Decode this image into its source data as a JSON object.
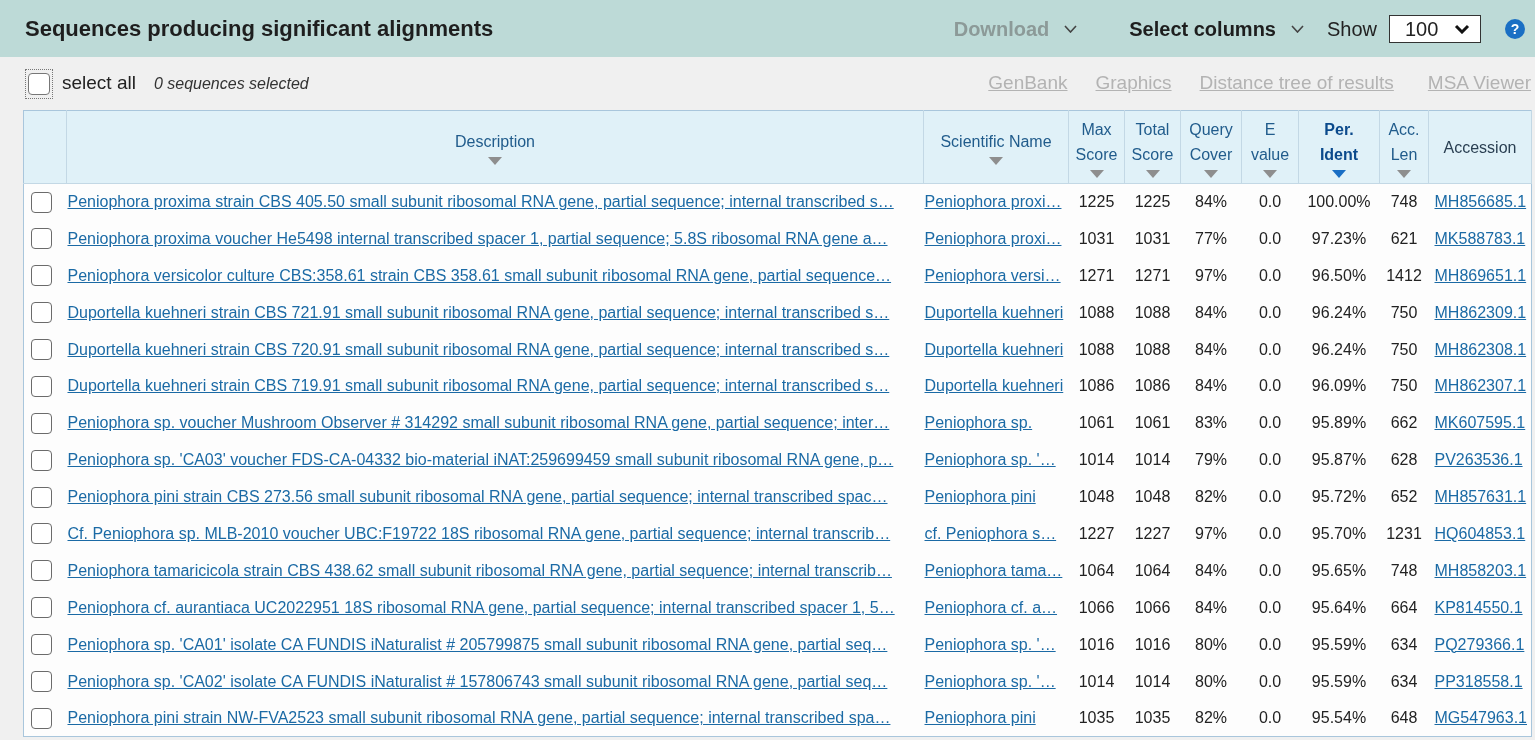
{
  "header": {
    "title": "Sequences producing significant alignments",
    "download": {
      "label": "Download",
      "disabled": true
    },
    "select_columns": {
      "label": "Select columns",
      "disabled": false
    },
    "show": {
      "label": "Show",
      "value": "100"
    },
    "help": {
      "label": "?"
    }
  },
  "toolbar": {
    "select_all": {
      "label": "select all",
      "checked": false,
      "focused": true
    },
    "selection_count": "0 sequences selected",
    "links": [
      {
        "label": "GenBank",
        "disabled": true
      },
      {
        "label": "Graphics",
        "disabled": true
      },
      {
        "label": "Distance tree of results",
        "disabled": true
      },
      {
        "label": "MSA Viewer",
        "disabled": true
      }
    ]
  },
  "table": {
    "columns": [
      {
        "label": "Description",
        "sortable": true,
        "sorted": false
      },
      {
        "label": "Scientific Name",
        "sortable": true,
        "sorted": false
      },
      {
        "label": "Max Score",
        "sortable": true,
        "sorted": false
      },
      {
        "label": "Total Score",
        "sortable": true,
        "sorted": false
      },
      {
        "label": "Query Cover",
        "sortable": true,
        "sorted": false
      },
      {
        "label": "E value",
        "sortable": true,
        "sorted": false
      },
      {
        "label": "Per. Ident",
        "sortable": true,
        "sorted": true
      },
      {
        "label": "Acc. Len",
        "sortable": true,
        "sorted": false
      },
      {
        "label": "Accession",
        "sortable": false,
        "sorted": false
      }
    ],
    "rows": [
      {
        "checked": false,
        "description": "Peniophora proxima strain CBS 405.50 small subunit ribosomal RNA gene, partial sequence; internal transcribed s…",
        "scientific_name": "Peniophora proxi…",
        "max_score": "1225",
        "total_score": "1225",
        "query_cover": "84%",
        "e_value": "0.0",
        "per_ident": "100.00%",
        "acc_len": "748",
        "accession": "MH856685.1"
      },
      {
        "checked": false,
        "description": "Peniophora proxima voucher He5498 internal transcribed spacer 1, partial sequence; 5.8S ribosomal RNA gene a…",
        "scientific_name": "Peniophora proxi…",
        "max_score": "1031",
        "total_score": "1031",
        "query_cover": "77%",
        "e_value": "0.0",
        "per_ident": "97.23%",
        "acc_len": "621",
        "accession": "MK588783.1"
      },
      {
        "checked": false,
        "description": "Peniophora versicolor culture CBS:358.61 strain CBS 358.61 small subunit ribosomal RNA gene, partial sequence…",
        "scientific_name": "Peniophora versi…",
        "max_score": "1271",
        "total_score": "1271",
        "query_cover": "97%",
        "e_value": "0.0",
        "per_ident": "96.50%",
        "acc_len": "1412",
        "accession": "MH869651.1"
      },
      {
        "checked": false,
        "description": "Duportella kuehneri strain CBS 721.91 small subunit ribosomal RNA gene, partial sequence; internal transcribed s…",
        "scientific_name": "Duportella kuehneri",
        "max_score": "1088",
        "total_score": "1088",
        "query_cover": "84%",
        "e_value": "0.0",
        "per_ident": "96.24%",
        "acc_len": "750",
        "accession": "MH862309.1"
      },
      {
        "checked": false,
        "description": "Duportella kuehneri strain CBS 720.91 small subunit ribosomal RNA gene, partial sequence; internal transcribed s…",
        "scientific_name": "Duportella kuehneri",
        "max_score": "1088",
        "total_score": "1088",
        "query_cover": "84%",
        "e_value": "0.0",
        "per_ident": "96.24%",
        "acc_len": "750",
        "accession": "MH862308.1"
      },
      {
        "checked": false,
        "description": "Duportella kuehneri strain CBS 719.91 small subunit ribosomal RNA gene, partial sequence; internal transcribed s…",
        "scientific_name": "Duportella kuehneri",
        "max_score": "1086",
        "total_score": "1086",
        "query_cover": "84%",
        "e_value": "0.0",
        "per_ident": "96.09%",
        "acc_len": "750",
        "accession": "MH862307.1"
      },
      {
        "checked": false,
        "description": "Peniophora sp. voucher Mushroom Observer # 314292 small subunit ribosomal RNA gene, partial sequence; inter…",
        "scientific_name": "Peniophora sp.",
        "max_score": "1061",
        "total_score": "1061",
        "query_cover": "83%",
        "e_value": "0.0",
        "per_ident": "95.89%",
        "acc_len": "662",
        "accession": "MK607595.1"
      },
      {
        "checked": false,
        "description": "Peniophora sp. 'CA03' voucher FDS-CA-04332 bio-material iNAT:259699459 small subunit ribosomal RNA gene, p…",
        "scientific_name": "Peniophora sp. '…",
        "max_score": "1014",
        "total_score": "1014",
        "query_cover": "79%",
        "e_value": "0.0",
        "per_ident": "95.87%",
        "acc_len": "628",
        "accession": "PV263536.1"
      },
      {
        "checked": false,
        "description": "Peniophora pini strain CBS 273.56 small subunit ribosomal RNA gene, partial sequence; internal transcribed spac…",
        "scientific_name": "Peniophora pini",
        "max_score": "1048",
        "total_score": "1048",
        "query_cover": "82%",
        "e_value": "0.0",
        "per_ident": "95.72%",
        "acc_len": "652",
        "accession": "MH857631.1"
      },
      {
        "checked": false,
        "description": "Cf. Peniophora sp. MLB-2010 voucher UBC:F19722 18S ribosomal RNA gene, partial sequence; internal transcrib…",
        "scientific_name": "cf. Peniophora s…",
        "max_score": "1227",
        "total_score": "1227",
        "query_cover": "97%",
        "e_value": "0.0",
        "per_ident": "95.70%",
        "acc_len": "1231",
        "accession": "HQ604853.1"
      },
      {
        "checked": false,
        "description": "Peniophora tamaricicola strain CBS 438.62 small subunit ribosomal RNA gene, partial sequence; internal transcrib…",
        "scientific_name": "Peniophora tama…",
        "max_score": "1064",
        "total_score": "1064",
        "query_cover": "84%",
        "e_value": "0.0",
        "per_ident": "95.65%",
        "acc_len": "748",
        "accession": "MH858203.1"
      },
      {
        "checked": false,
        "description": "Peniophora cf. aurantiaca UC2022951 18S ribosomal RNA gene, partial sequence; internal transcribed spacer 1, 5…",
        "scientific_name": "Peniophora cf. a…",
        "max_score": "1066",
        "total_score": "1066",
        "query_cover": "84%",
        "e_value": "0.0",
        "per_ident": "95.64%",
        "acc_len": "664",
        "accession": "KP814550.1"
      },
      {
        "checked": false,
        "description": "Peniophora sp. 'CA01' isolate CA FUNDIS iNaturalist # 205799875 small subunit ribosomal RNA gene, partial seq…",
        "scientific_name": "Peniophora sp. '…",
        "max_score": "1016",
        "total_score": "1016",
        "query_cover": "80%",
        "e_value": "0.0",
        "per_ident": "95.59%",
        "acc_len": "634",
        "accession": "PQ279366.1"
      },
      {
        "checked": false,
        "description": "Peniophora sp. 'CA02' isolate CA FUNDIS iNaturalist # 157806743 small subunit ribosomal RNA gene, partial seq…",
        "scientific_name": "Peniophora sp. '…",
        "max_score": "1014",
        "total_score": "1014",
        "query_cover": "80%",
        "e_value": "0.0",
        "per_ident": "95.59%",
        "acc_len": "634",
        "accession": "PP318558.1"
      },
      {
        "checked": false,
        "description": "Peniophora pini strain NW-FVA2523 small subunit ribosomal RNA gene, partial sequence; internal transcribed spa…",
        "scientific_name": "Peniophora pini",
        "max_score": "1035",
        "total_score": "1035",
        "query_cover": "82%",
        "e_value": "0.0",
        "per_ident": "95.54%",
        "acc_len": "648",
        "accession": "MG547963.1"
      }
    ]
  }
}
